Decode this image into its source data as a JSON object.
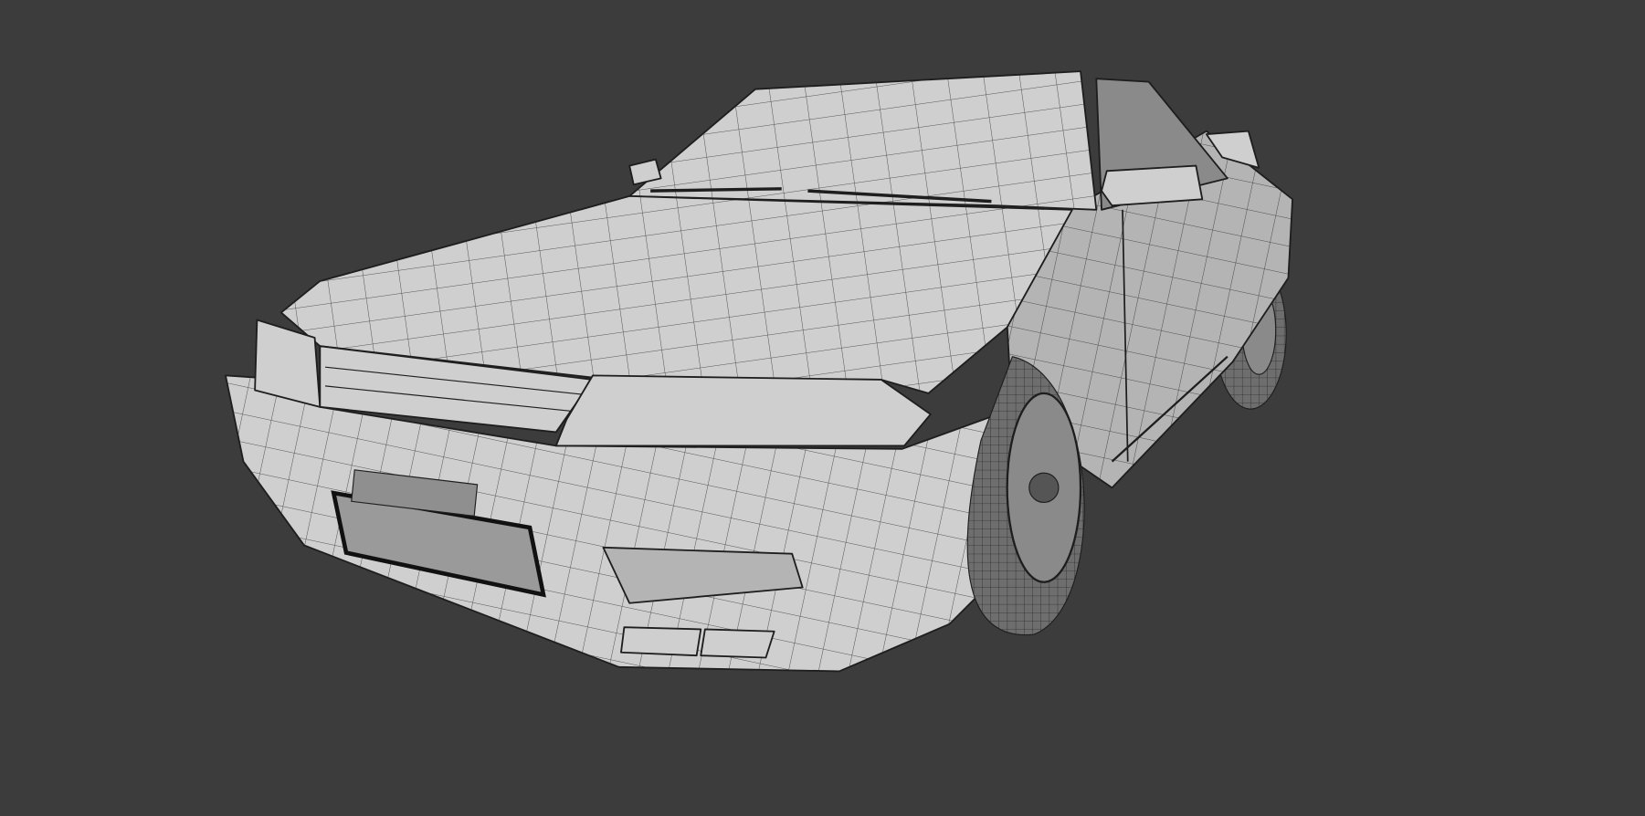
{
  "viewport": {
    "background_color": "#3c3c3c",
    "mesh_light": "#cfcfcf",
    "mesh_mid": "#b4b4b4",
    "mesh_dark": "#8a8a8a",
    "wire_color": "#2a2a2a",
    "tire_color": "#6e6e6e"
  }
}
